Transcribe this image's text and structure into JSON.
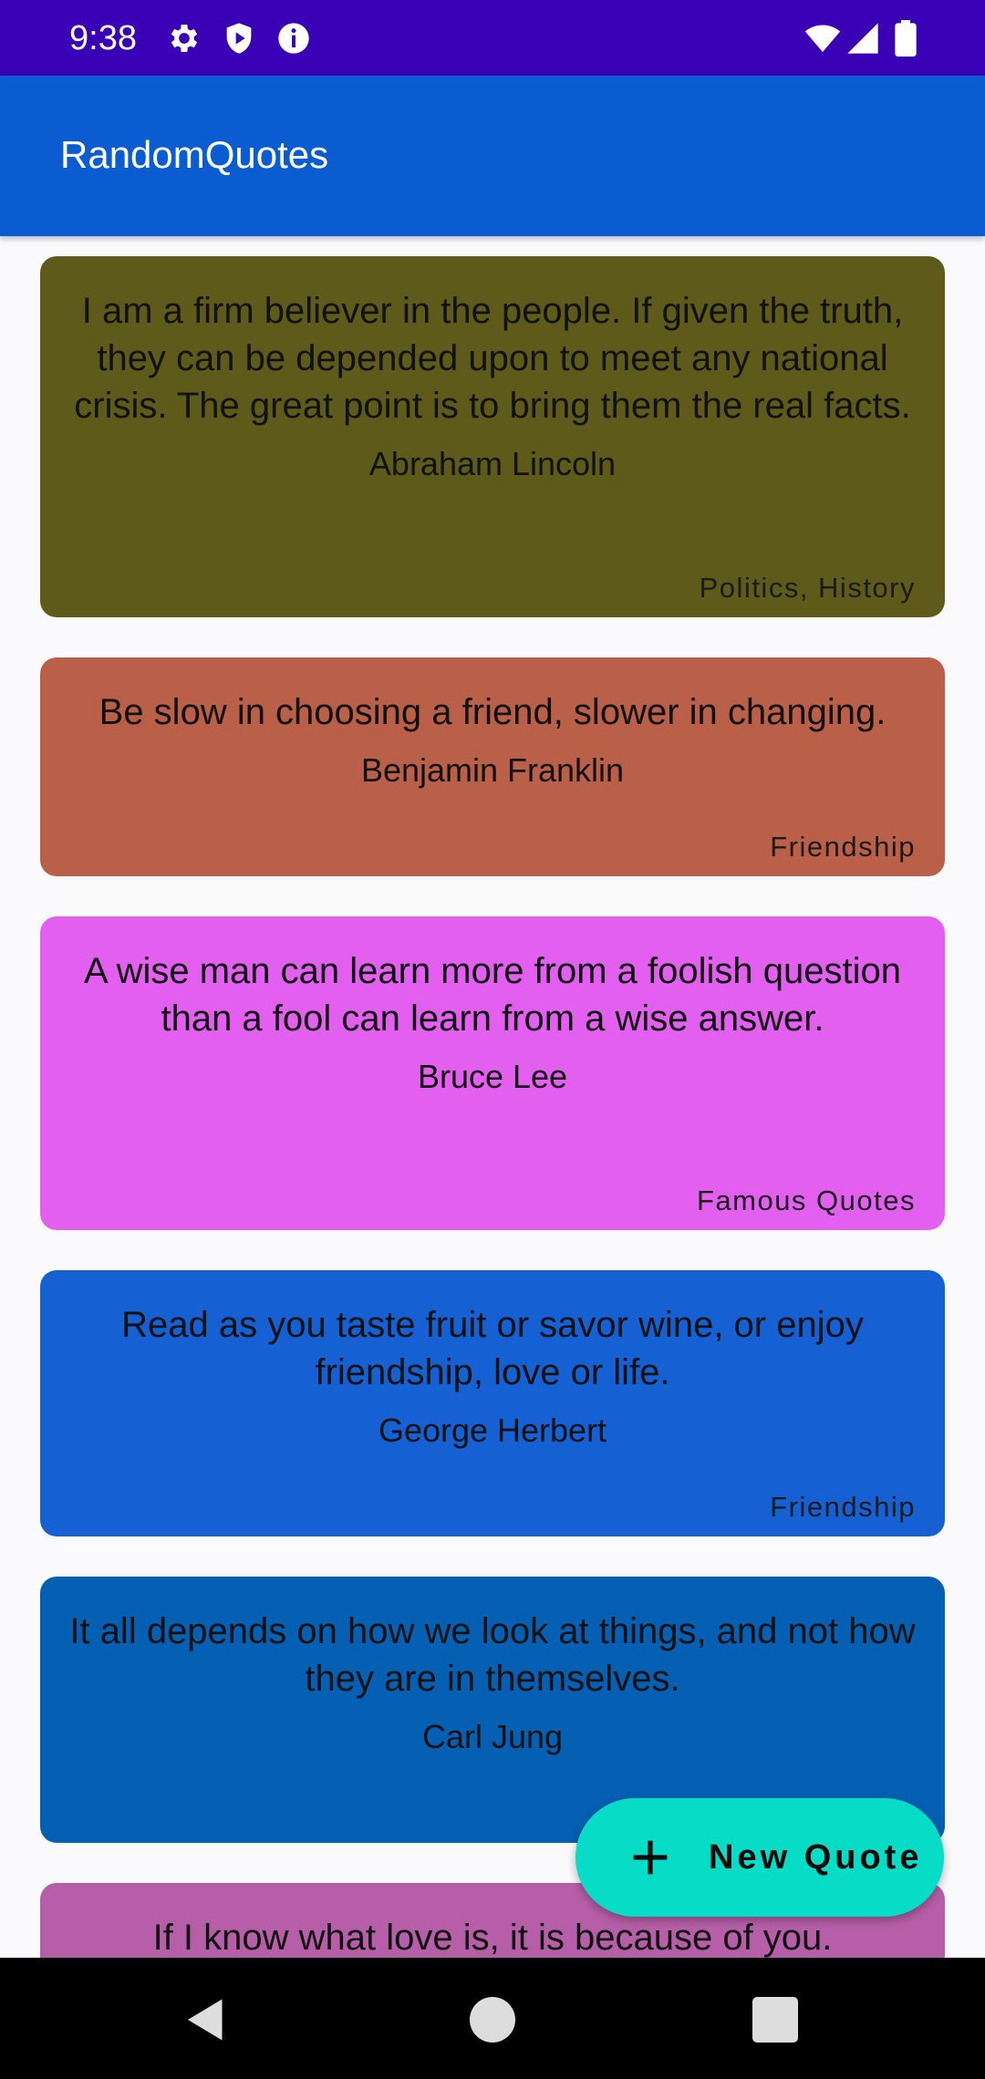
{
  "status_bar": {
    "time": "9:38",
    "icons": [
      "gear-icon",
      "shield-icon",
      "info-icon",
      "wifi-icon",
      "cellular-signal-icon",
      "battery-icon"
    ]
  },
  "app_bar": {
    "title": "RandomQuotes"
  },
  "quotes": [
    {
      "text": "I am a firm believer in the people. If given the truth, they can be depended upon to meet any national crisis. The great point is to bring them the real facts.",
      "author": "Abraham Lincoln",
      "tags": "Politics, History",
      "color": "#5e5a1a"
    },
    {
      "text": "Be slow in choosing a friend, slower in changing.",
      "author": "Benjamin Franklin",
      "tags": "Friendship",
      "color": "#ba5f48"
    },
    {
      "text": "A wise man can learn more from a foolish question than a fool can learn from a wise answer.",
      "author": "Bruce Lee",
      "tags": "Famous Quotes",
      "color": "#e35ff0"
    },
    {
      "text": "Read as you taste fruit or savor wine, or enjoy friendship, love or life.",
      "author": "George Herbert",
      "tags": "Friendship",
      "color": "#1560d2"
    },
    {
      "text": "It all depends on how we look at things, and not how they are in themselves.",
      "author": "Carl Jung",
      "tags": "",
      "color": "#055fb2"
    },
    {
      "text": "If I know what love is, it is because of you.",
      "author": "",
      "tags": "",
      "color": "#b65fa8"
    }
  ],
  "fab": {
    "label": "New Quote",
    "icon": "plus-icon",
    "color": "#06dcc6"
  },
  "nav_bar": {
    "icons": [
      "back-icon",
      "home-icon",
      "recents-icon"
    ]
  }
}
